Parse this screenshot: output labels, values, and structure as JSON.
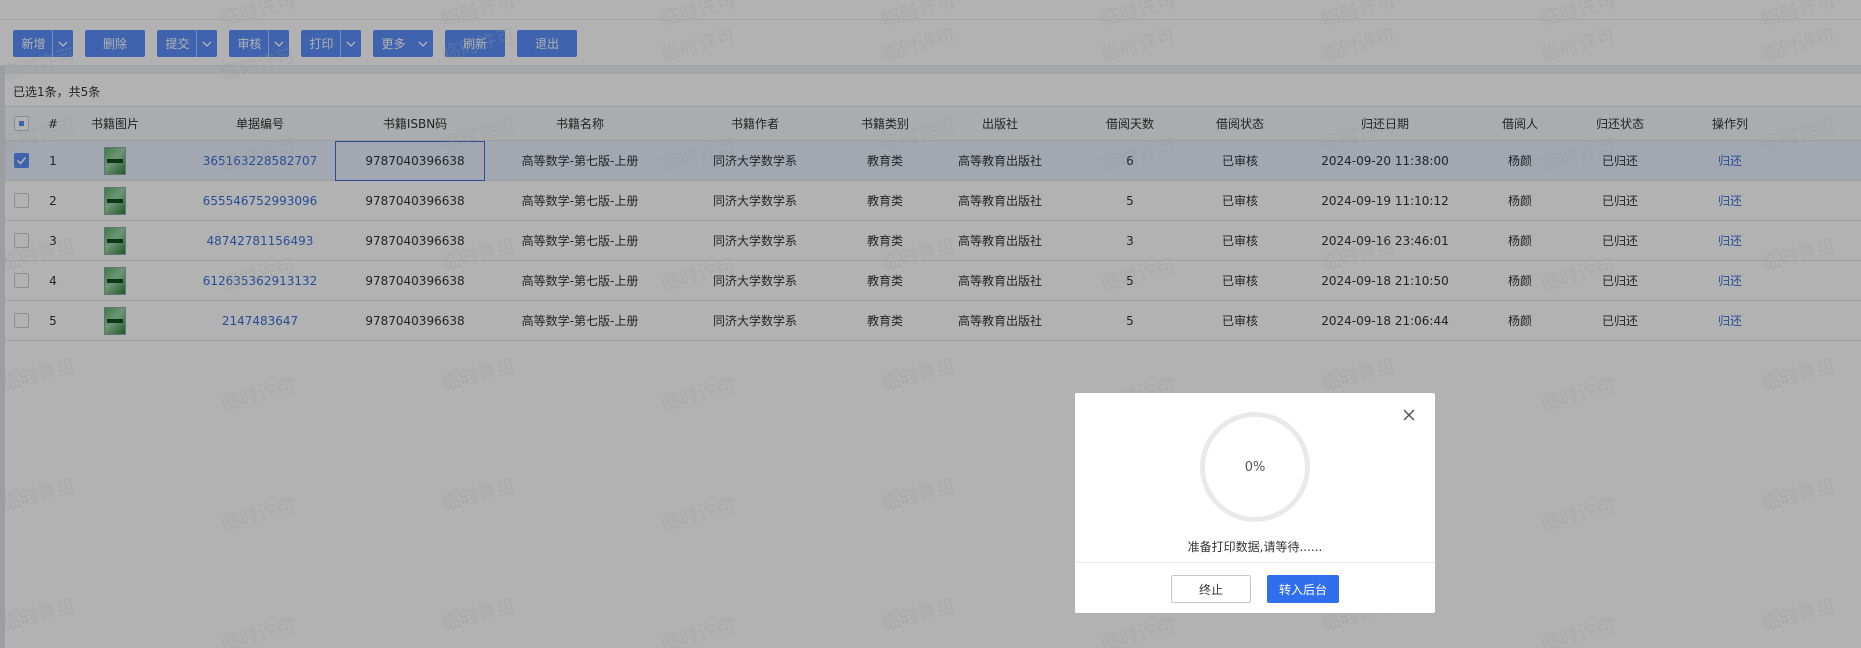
{
  "toolbar": {
    "buttons": [
      {
        "label": "新增",
        "has_menu": true
      },
      {
        "label": "删除",
        "has_menu": false
      },
      {
        "label": "提交",
        "has_menu": true
      },
      {
        "label": "审核",
        "has_menu": true
      },
      {
        "label": "打印",
        "has_menu": true
      },
      {
        "label": "更多",
        "has_menu": true
      },
      {
        "label": "刷新",
        "has_menu": false
      },
      {
        "label": "退出",
        "has_menu": false
      }
    ]
  },
  "selection_info": "已选1条，共5条",
  "table": {
    "columns": [
      "#",
      "书籍图片",
      "单据编号",
      "书籍ISBN码",
      "书籍名称",
      "书籍作者",
      "书籍类别",
      "出版社",
      "借阅天数",
      "借阅状态",
      "归还日期",
      "借阅人",
      "归还状态",
      "操作列"
    ],
    "rows": [
      {
        "selected": true,
        "no": "1",
        "doc_no": "365163228582707",
        "isbn": "9787040396638",
        "name": "高等数学-第七版-上册",
        "author": "同济大学数学系",
        "category": "教育类",
        "publisher": "高等教育出版社",
        "days": "6",
        "borrow_status": "已审核",
        "return_date": "2024-09-20 11:38:00",
        "borrower": "杨颜",
        "return_status": "已归还",
        "action": "归还"
      },
      {
        "selected": false,
        "no": "2",
        "doc_no": "655546752993096",
        "isbn": "9787040396638",
        "name": "高等数学-第七版-上册",
        "author": "同济大学数学系",
        "category": "教育类",
        "publisher": "高等教育出版社",
        "days": "5",
        "borrow_status": "已审核",
        "return_date": "2024-09-19 11:10:12",
        "borrower": "杨颜",
        "return_status": "已归还",
        "action": "归还"
      },
      {
        "selected": false,
        "no": "3",
        "doc_no": "48742781156493",
        "isbn": "9787040396638",
        "name": "高等数学-第七版-上册",
        "author": "同济大学数学系",
        "category": "教育类",
        "publisher": "高等教育出版社",
        "days": "3",
        "borrow_status": "已审核",
        "return_date": "2024-09-16 23:46:01",
        "borrower": "杨颜",
        "return_status": "已归还",
        "action": "归还"
      },
      {
        "selected": false,
        "no": "4",
        "doc_no": "612635362913132",
        "isbn": "9787040396638",
        "name": "高等数学-第七版-上册",
        "author": "同济大学数学系",
        "category": "教育类",
        "publisher": "高等教育出版社",
        "days": "5",
        "borrow_status": "已审核",
        "return_date": "2024-09-18 21:10:50",
        "borrower": "杨颜",
        "return_status": "已归还",
        "action": "归还"
      },
      {
        "selected": false,
        "no": "5",
        "doc_no": "2147483647",
        "isbn": "9787040396638",
        "name": "高等数学-第七版-上册",
        "author": "同济大学数学系",
        "category": "教育类",
        "publisher": "高等教育出版社",
        "days": "5",
        "borrow_status": "已审核",
        "return_date": "2024-09-18 21:06:44",
        "borrower": "杨颜",
        "return_status": "已归还",
        "action": "归还"
      }
    ]
  },
  "watermark_text": "临时许可",
  "dialog": {
    "progress_value": 0,
    "progress_label": "0%",
    "message": "准备打印数据,请等待......",
    "stop_label": "终止",
    "background_label": "转入后台",
    "close_icon": "close-icon"
  },
  "colors": {
    "primary_button": "#5b8ff9",
    "link": "#3a6fd8",
    "dialog_primary": "#2f6fed"
  }
}
